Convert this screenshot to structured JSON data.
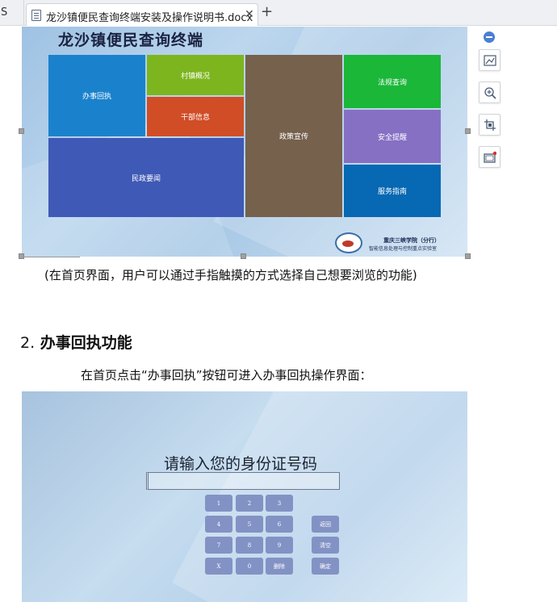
{
  "tabs": {
    "prev_partial": "S",
    "active_title": "龙沙镇便民查询终端安装及操作说明书.docx",
    "close_glyph": "✕",
    "add_glyph": "+"
  },
  "kiosk_home": {
    "title": "龙沙镇便民查询终端",
    "tiles": {
      "banshi": "办事回执",
      "cunzhen": "村镇概况",
      "ganbu": "干部信息",
      "zhengce": "政策宣传",
      "fagui": "法规查询",
      "anquan": "安全提醒",
      "fuwu": "服务指南",
      "minzheng": "民政要闻"
    },
    "colors": {
      "banshi": "#1a82cc",
      "cunzhen": "#7db51e",
      "ganbu": "#d04d26",
      "zhengce": "#76614d",
      "fagui": "#1ab739",
      "anquan": "#8670c4",
      "fuwu": "#0768b3",
      "minzheng": "#3f59b6"
    },
    "footer_line1": "重庆三峡学院（分行）",
    "footer_line2": "智能信息处理与控制重点实验室"
  },
  "image_toolbar": {
    "icons": [
      "collapse-icon",
      "image-layout-icon",
      "zoom-in-icon",
      "crop-icon",
      "frame-icon"
    ]
  },
  "document": {
    "caption": "(在首页界面，用户可以通过手指触摸的方式选择自己想要浏览的功能)",
    "heading_number": "2.",
    "heading_text": "办事回执功能",
    "paragraph": "在首页点击“办事回执”按钮可进入办事回执操作界面："
  },
  "receipt_screen": {
    "prompt": "请输入您的身份证号码",
    "keys": {
      "k1": "1",
      "k2": "2",
      "k3": "3",
      "k4": "4",
      "k5": "5",
      "k6": "6",
      "k7": "7",
      "k8": "8",
      "k9": "9",
      "kx": "X",
      "k0": "0",
      "kdel": "删除",
      "back": "返回",
      "clear": "清空",
      "ok": "确定"
    }
  }
}
